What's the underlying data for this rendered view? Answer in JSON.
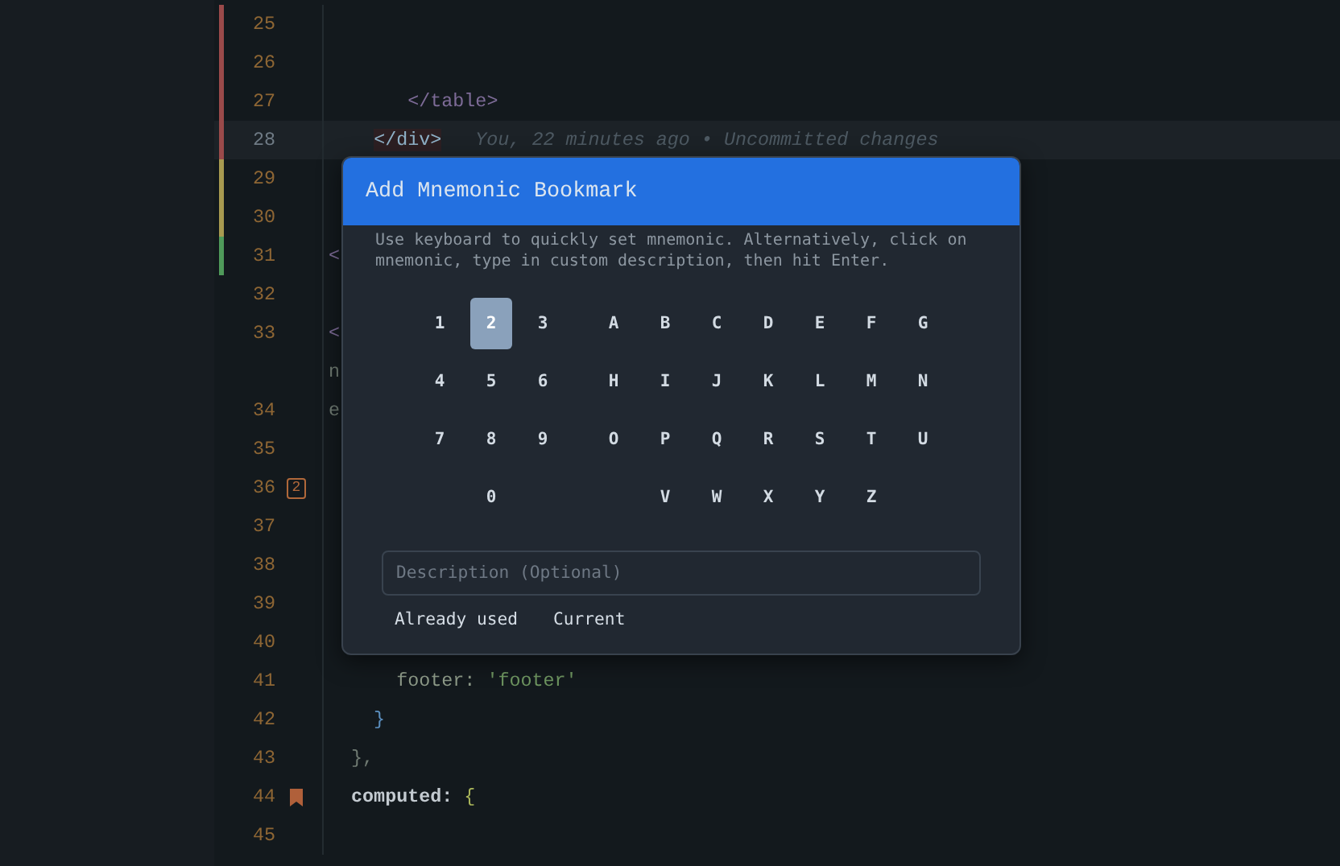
{
  "editor": {
    "lines": [
      {
        "number": "25",
        "color": "#9a4a4a",
        "current": false
      },
      {
        "number": "26",
        "color": "#9a4a4a",
        "current": false
      },
      {
        "number": "27",
        "color": "#9a4a4a",
        "current": false,
        "tokens": [
          {
            "text": "       </table>",
            "kind": "tag"
          }
        ]
      },
      {
        "number": "28",
        "color": "#9a4a4a",
        "current": true,
        "tokens": [
          {
            "text": "    </div>",
            "kind": "matched-tag"
          }
        ],
        "blame": "You, 22 minutes ago • Uncommitted changes"
      },
      {
        "number": "29",
        "color": "#a89a50",
        "current": false
      },
      {
        "number": "30",
        "color": "#a89a50",
        "current": false
      },
      {
        "number": "31",
        "color": "#4f9a5a",
        "current": false,
        "tokens": [
          {
            "text": "<",
            "kind": "tag"
          }
        ]
      },
      {
        "number": "32",
        "current": false
      },
      {
        "number": "33",
        "current": false,
        "tokens": [
          {
            "text": "<",
            "kind": "tag"
          }
        ],
        "wrapped_tokens": [
          {
            "text": "n",
            "kind": "plain"
          }
        ]
      },
      {
        "number": "34",
        "current": false,
        "tokens": [
          {
            "text": "e",
            "kind": "plain"
          }
        ]
      },
      {
        "number": "35",
        "current": false
      },
      {
        "number": "36",
        "current": false,
        "badge": "2"
      },
      {
        "number": "37",
        "current": false
      },
      {
        "number": "38",
        "current": false
      },
      {
        "number": "39",
        "current": false
      },
      {
        "number": "40",
        "current": false
      },
      {
        "number": "41",
        "current": false,
        "tokens": [
          {
            "text": "      footer:",
            "kind": "key"
          },
          {
            "text": " 'footer'",
            "kind": "string"
          }
        ]
      },
      {
        "number": "42",
        "current": false,
        "tokens": [
          {
            "text": "    }",
            "kind": "punct"
          }
        ]
      },
      {
        "number": "43",
        "current": false,
        "tokens": [
          {
            "text": "  },",
            "kind": "plain"
          }
        ]
      },
      {
        "number": "44",
        "current": false,
        "bookmark": true,
        "tokens": [
          {
            "text": "  computed:",
            "kind": "bold"
          },
          {
            "text": " {",
            "kind": "brace"
          }
        ]
      },
      {
        "number": "45",
        "current": false
      }
    ]
  },
  "dialog": {
    "title": "Add Mnemonic Bookmark",
    "description": "Use keyboard to quickly set mnemonic. Alternatively, click on mnemonic, type in custom description, then hit Enter.",
    "key_rows": [
      {
        "digits": [
          {
            "label": "1",
            "selected": false
          },
          {
            "label": "2",
            "selected": true
          },
          {
            "label": "3",
            "selected": false
          }
        ],
        "letters": [
          {
            "label": "A",
            "selected": false
          },
          {
            "label": "B",
            "selected": false
          },
          {
            "label": "C",
            "selected": false
          },
          {
            "label": "D",
            "selected": false
          },
          {
            "label": "E",
            "selected": false
          },
          {
            "label": "F",
            "selected": false
          },
          {
            "label": "G",
            "selected": false
          }
        ]
      },
      {
        "digits": [
          {
            "label": "4",
            "selected": false
          },
          {
            "label": "5",
            "selected": false
          },
          {
            "label": "6",
            "selected": false
          }
        ],
        "letters": [
          {
            "label": "H",
            "selected": false
          },
          {
            "label": "I",
            "selected": false
          },
          {
            "label": "J",
            "selected": false
          },
          {
            "label": "K",
            "selected": false
          },
          {
            "label": "L",
            "selected": false
          },
          {
            "label": "M",
            "selected": false
          },
          {
            "label": "N",
            "selected": false
          }
        ]
      },
      {
        "digits": [
          {
            "label": "7",
            "selected": false
          },
          {
            "label": "8",
            "selected": false
          },
          {
            "label": "9",
            "selected": false
          }
        ],
        "letters": [
          {
            "label": "O",
            "selected": false
          },
          {
            "label": "P",
            "selected": false
          },
          {
            "label": "Q",
            "selected": false
          },
          {
            "label": "R",
            "selected": false
          },
          {
            "label": "S",
            "selected": false
          },
          {
            "label": "T",
            "selected": false
          },
          {
            "label": "U",
            "selected": false
          }
        ]
      },
      {
        "digits": [
          {
            "label": "0",
            "selected": false
          }
        ],
        "letters": [
          {
            "label": "V",
            "selected": false
          },
          {
            "label": "W",
            "selected": false
          },
          {
            "label": "X",
            "selected": false
          },
          {
            "label": "Y",
            "selected": false
          },
          {
            "label": "Z",
            "selected": false
          }
        ]
      }
    ],
    "description_field": {
      "placeholder": "Description (Optional)"
    },
    "legend": [
      "Already used",
      "Current"
    ]
  }
}
